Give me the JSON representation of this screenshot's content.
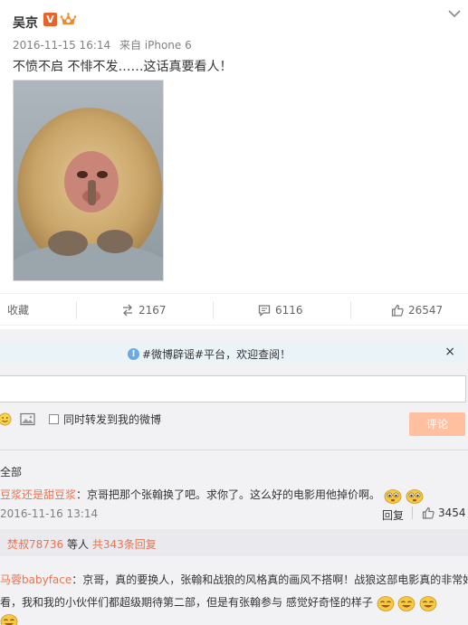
{
  "post": {
    "author": "吴京",
    "verified_badge": "V",
    "timestamp": "2016-11-15 16:14",
    "source": "来自 iPhone 6",
    "text": "不愤不启 不悱不发……这话真要看人！",
    "image_subject": "monkey-photo"
  },
  "actions": {
    "favorite": "收藏",
    "repost_count": "2167",
    "comment_count": "6116",
    "like_count": "26547"
  },
  "notice": {
    "text": "#微博辟谣#平台，欢迎查阅！",
    "close": "×"
  },
  "composer": {
    "repost_label": "同时转发到我的微博",
    "submit_label": "评论"
  },
  "comments_header": "全部",
  "comments": [
    {
      "user": "豆浆还是甜豆浆",
      "text": "：京哥把那个张翰换了吧。求你了。这么好的电影用他掉价啊。",
      "time": "2016-11-16 13:14",
      "reply_label": "回复",
      "likes": "3454"
    },
    {
      "user": "马蓉babyface",
      "text": "：京哥，真的要换人，张翰和战狼的风格真的画风不搭啊！战狼这部电影真的非常好",
      "text2": "看，我和我的小伙伴们都超级期待第二部，但是有张翰参与 感觉好奇怪的样子"
    }
  ],
  "sub_replies": {
    "user": "焚叔78736",
    "rest": " 等人 ",
    "count": "共343条回复"
  },
  "colors": {
    "accent": "#eb7350",
    "submit_disabled": "#ffc09f",
    "notice_bg": "#eaf3f8"
  }
}
